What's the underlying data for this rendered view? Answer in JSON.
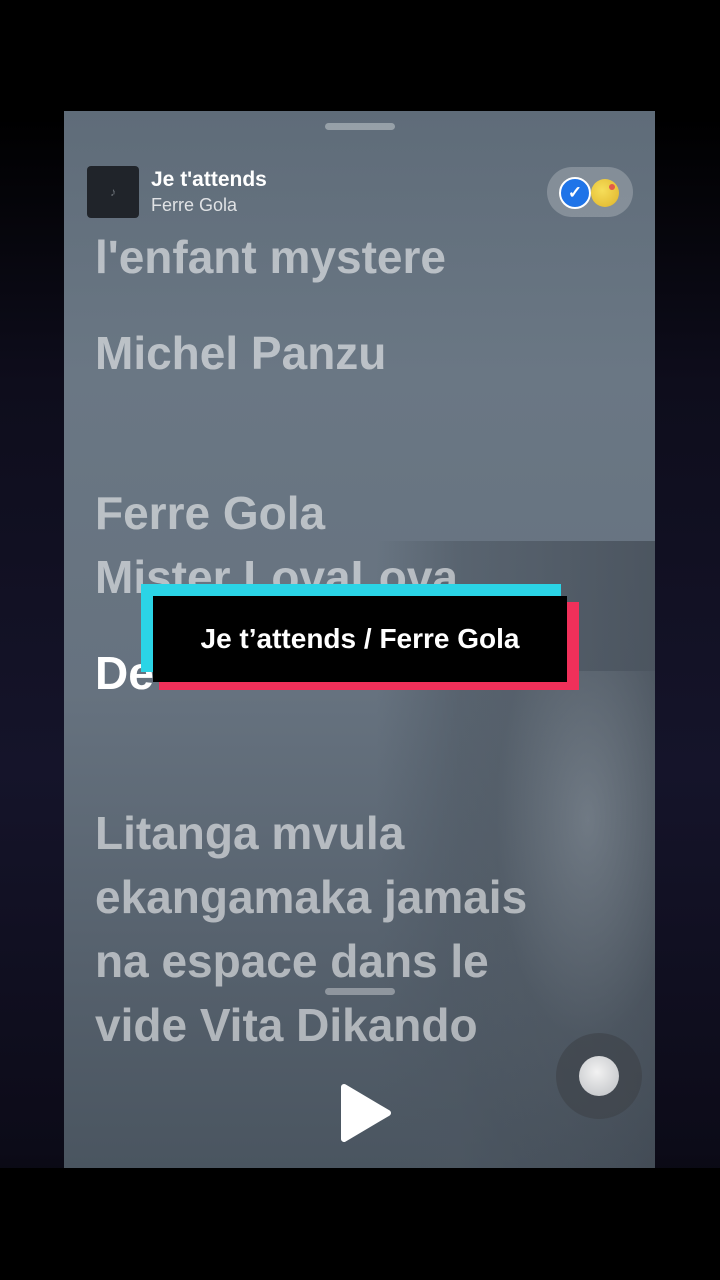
{
  "now_playing": {
    "title": "Je t'attends",
    "artist": "Ferre Gola",
    "art_glyph": "♪"
  },
  "badges": {
    "check_glyph": "✓",
    "check_color": "#1f74e8"
  },
  "lyrics": [
    {
      "text": "l'enfant mystere"
    },
    {
      "text": "Michel Panzu"
    },
    {
      "text": "Ferre Gola\nMister LovaLova"
    },
    {
      "text": "De"
    },
    {
      "text": "Litanga mvula\nekangamaka jamais\nna espace dans le\nvide Vita Dikando"
    }
  ],
  "caption": {
    "text": "Je t’attends / Ferre Gola",
    "cyan": "#2bd4e6",
    "red": "#f0305a"
  },
  "controls": {
    "play_icon": "play-icon"
  }
}
